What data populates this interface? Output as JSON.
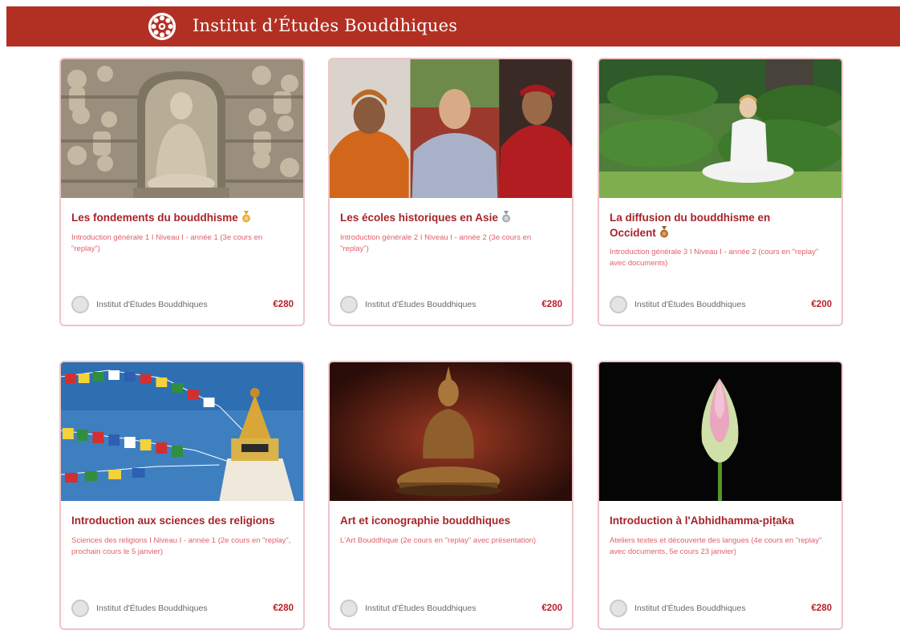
{
  "header": {
    "title": "Institut d’Études Bouddhiques",
    "background": "#b23023"
  },
  "courses": [
    {
      "title": "Les fondements du bouddhisme",
      "medal": "gold-medal-icon",
      "description": "Introduction générale 1 I Niveau I - année 1 (3e cours en \"replay\")",
      "author": "Institut d'Études Bouddhiques",
      "price": "€280",
      "image": "buddha-relief-carving"
    },
    {
      "title": "Les écoles historiques en Asie",
      "medal": "silver-medal-icon",
      "description": "Introduction générale 2 I Niveau I - année 2 (3e cours en \"replay\")",
      "author": "Institut d'Études Bouddhiques",
      "price": "€280",
      "image": "three-monks-photo"
    },
    {
      "title_line1": "La diffusion du bouddhisme en",
      "title_line2": "Occident",
      "medal": "bronze-medal-icon",
      "description": "Introduction générale 3 I Niveau I - année 2 (cours en \"replay\" avec documents)",
      "author": "Institut d'Études Bouddhiques",
      "price": "€200",
      "image": "meditation-garden-photo"
    },
    {
      "title": "Introduction aux sciences des religions",
      "description": "Sciences des religions I Niveau I - année 1 (2e cours en \"replay\", prochain cours le 5 janvier)",
      "author": "Institut d'Études Bouddhiques",
      "price": "€280",
      "image": "stupa-prayer-flags-photo"
    },
    {
      "title": "Art et iconographie bouddhiques",
      "description": "L'Art Bouddhique (2e cours en \"replay\" avec présentation)",
      "author": "Institut d'Études Bouddhiques",
      "price": "€200",
      "image": "bronze-buddha-statue-photo"
    },
    {
      "title": "Introduction à l'Abhidhamma-piṭaka",
      "description": "Ateliers textes et découverte des langues (4e cours en \"replay\" avec documents, 5e cours 23 janvier)",
      "author": "Institut d'Études Bouddhiques",
      "price": "€280",
      "image": "lotus-bud-photo"
    }
  ],
  "colors": {
    "title": "#a8232a",
    "description": "#e0606a",
    "price": "#b8202a",
    "card_border": "#f0c4c8"
  }
}
